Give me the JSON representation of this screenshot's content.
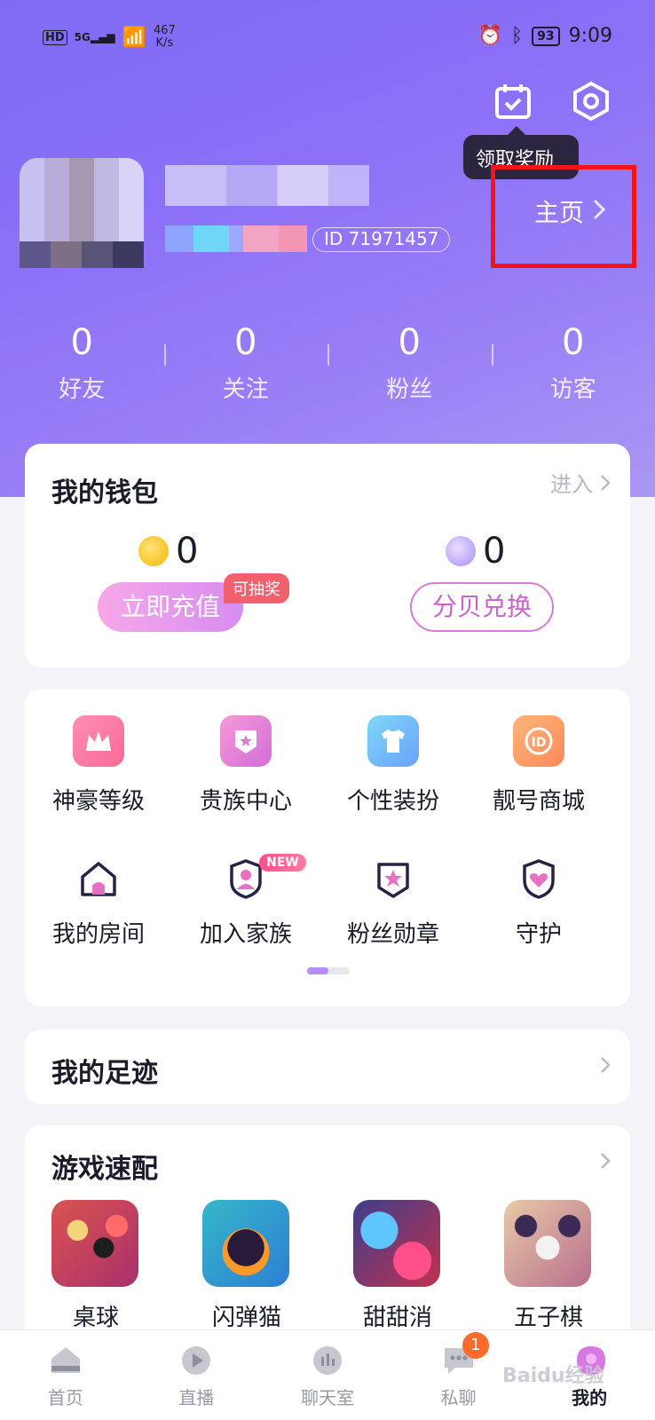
{
  "status_bar": {
    "network_speed": "467",
    "speed_unit": "K/s",
    "battery": "93",
    "time": "9:09"
  },
  "header": {
    "tooltip": "领取奖励",
    "id_text": "ID 71971457",
    "home_link": "主页",
    "icons": [
      "calendar-check-icon",
      "settings-hexagon-icon"
    ]
  },
  "stats": [
    {
      "value": "0",
      "label": "好友"
    },
    {
      "value": "0",
      "label": "关注"
    },
    {
      "value": "0",
      "label": "粉丝"
    },
    {
      "value": "0",
      "label": "访客"
    }
  ],
  "wallet": {
    "title": "我的钱包",
    "enter": "进入",
    "coins": "0",
    "shells": "0",
    "recharge_btn": "立即充值",
    "lottery_badge": "可抽奖",
    "exchange_btn": "分贝兑换"
  },
  "features": {
    "row1": [
      {
        "label": "神豪等级",
        "icon": "crown-icon"
      },
      {
        "label": "贵族中心",
        "icon": "badge-star-icon"
      },
      {
        "label": "个性装扮",
        "icon": "tshirt-icon"
      },
      {
        "label": "靓号商城",
        "icon": "id-icon"
      }
    ],
    "row2": [
      {
        "label": "我的房间",
        "icon": "house-icon"
      },
      {
        "label": "加入家族",
        "icon": "family-icon"
      },
      {
        "label": "粉丝勋章",
        "icon": "star-medal-icon"
      },
      {
        "label": "守护",
        "icon": "heart-shield-icon"
      }
    ],
    "new_badge": "NEW"
  },
  "footprint": {
    "title": "我的足迹"
  },
  "games": {
    "title": "游戏速配",
    "items": [
      "桌球",
      "闪弹猫",
      "甜甜消",
      "五子棋"
    ]
  },
  "tabbar": {
    "items": [
      "首页",
      "直播",
      "聊天室",
      "私聊",
      "我的"
    ],
    "badge": "1",
    "active_index": 4
  },
  "watermark": "Baidu经验",
  "colors": {
    "accent": "#8b6ff7",
    "highlight": "#f2141b",
    "badge": "#ff6a2a"
  }
}
